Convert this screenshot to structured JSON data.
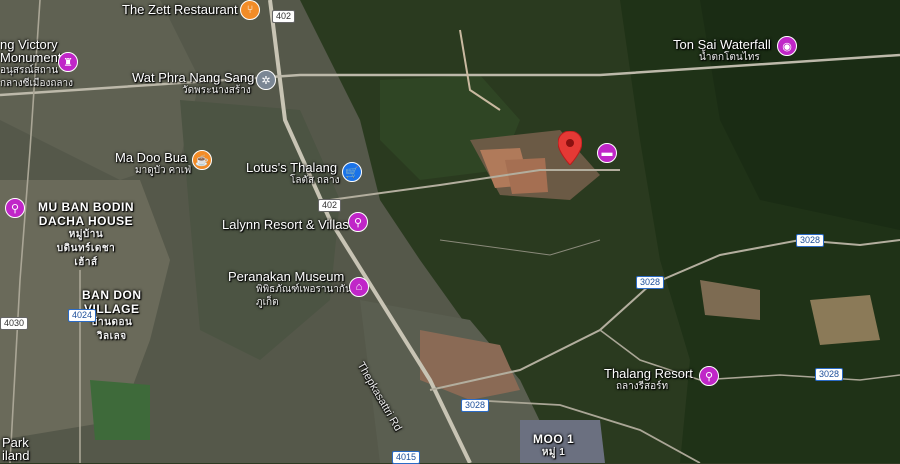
{
  "map": {
    "type": "satellite",
    "colors": {
      "forest": "#26381c",
      "urban": "#6d6a5c",
      "road": "#b9b6a8",
      "pin": "#e53935",
      "poi_purple": "#c026c8"
    }
  },
  "places": {
    "zett": "The Zett Restaurant",
    "victory": "ng Victory",
    "victory2": "Monument",
    "victory_th": "อนุสรณ์สถาน",
    "victory_th2": "กลางซีเมืองถลาง",
    "wat": "Wat Phra Nang Sang",
    "wat_th": "วัดพระนางสร้าง",
    "madoo": "Ma Doo Bua",
    "madoo_th": "มาดูบัว คาเฟ่",
    "lotus": "Lotus's Thalang",
    "lotus_th": "โลตัส ถลาง",
    "lalynn": "Lalynn Resort & Villas",
    "peranakan": "Peranakan Museum",
    "peranakan_th": "พิพิธภัณฑ์เพอรานากัน ภูเก็ต",
    "musban": "MU BAN BODIN",
    "musban2": "DACHA HOUSE",
    "musban_th": "หมู่บ้าน",
    "musban_th2": "บดินทร์เดชา",
    "musban_th3": "เฮ้าส์",
    "bandon": "BAN DON",
    "bandon2": "VILLAGE",
    "bandon_th": "บ้านดอน",
    "bandon_th2": "วิลเลจ",
    "tonsai": "Ton Sai Waterfall",
    "tonsai_th": "น้ำตกโตนไทร",
    "thalangresort": "Thalang Resort",
    "thalangresort_th": "ถลางรีสอร์ท",
    "moo1": "MOO 1",
    "moo1_th": "หมู่ 1",
    "park": "Park",
    "park2": "iland",
    "road_name": "Thepkasattri Rd"
  },
  "shields": {
    "r402a": "402",
    "r402b": "402",
    "r3028a": "3028",
    "r3028b": "3028",
    "r3028c": "3028",
    "r3028d": "3028",
    "r4024": "4024",
    "r4030": "4030",
    "r4015": "4015"
  },
  "icons": {
    "restaurant": "restaurant-icon",
    "landmark": "monument-icon",
    "temple": "temple-icon",
    "cafe": "cafe-icon",
    "shopping": "shopping-icon",
    "hotel": "hotel-icon",
    "museum": "museum-icon",
    "camera": "camera-icon",
    "pin": "location-pin-icon"
  }
}
